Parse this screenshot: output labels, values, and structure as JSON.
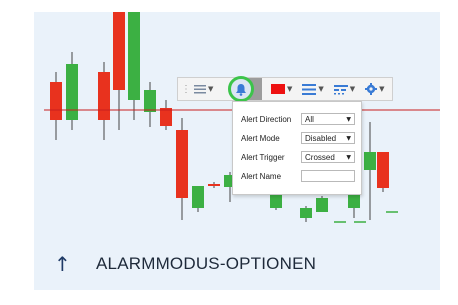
{
  "footer": {
    "title": "ALARMMODUS-OPTIONEN",
    "expand_icon": "arrow-up-icon"
  },
  "toolbar": {
    "items": [
      "drag-handle-icon",
      "indicator-list-icon",
      "bell-icon",
      "color-picker",
      "line-weight-icon",
      "line-style-icon",
      "settings-gear-icon"
    ],
    "line_color": "#ee1111",
    "active_highlight": "#3cc44a"
  },
  "alert_panel": {
    "direction": {
      "label": "Alert Direction",
      "value": "All"
    },
    "mode": {
      "label": "Alert Mode",
      "value": "Disabled"
    },
    "trigger": {
      "label": "Alert Trigger",
      "value": "Crossed"
    },
    "name": {
      "label": "Alert Name",
      "value": ""
    }
  },
  "colors": {
    "up": "#3cb043",
    "down": "#e8321e",
    "line": "#c81e1e",
    "background": "#eaf2fa"
  }
}
